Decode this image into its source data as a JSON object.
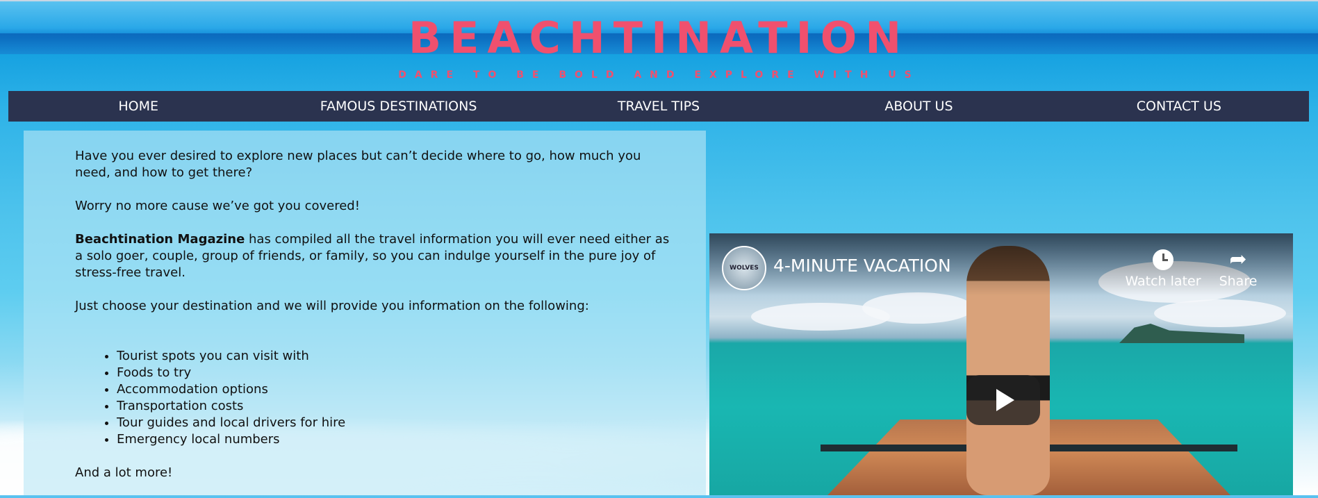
{
  "site": {
    "logo": "BEACHTINATION",
    "tagline": "DARE TO BE BOLD AND EXPLORE WITH US"
  },
  "nav": {
    "items": [
      {
        "label": "HOME"
      },
      {
        "label": "FAMOUS DESTINATIONS"
      },
      {
        "label": "TRAVEL TIPS"
      },
      {
        "label": "ABOUT US"
      },
      {
        "label": "CONTACT US"
      }
    ]
  },
  "intro": {
    "p1": "Have you ever desired to explore new places but can’t decide where to go, how much you need, and how to get there?",
    "p2": "Worry no more cause we’ve got you covered!",
    "p3_bold": "Beachtination Magazine",
    "p3_rest": " has compiled all the travel information you will ever need either as a solo goer, couple, group of friends, or family, so you can indulge yourself in the pure joy of stress-free travel.",
    "p4": "Just choose your destination and we will provide you information on the following:",
    "list": [
      "Tourist spots you can visit with",
      "Foods to try",
      "Accommodation options",
      "Transportation costs",
      "Tour guides and local drivers for hire",
      "Emergency local numbers"
    ],
    "p5": "And a lot more!"
  },
  "video": {
    "title": "4-MINUTE VACATION",
    "channel_avatar_text": "WOLVES",
    "watch_later": "Watch later",
    "share": "Share",
    "icons": {
      "watch_later": "clock-icon",
      "share": "share-arrow-icon",
      "play": "play-icon"
    }
  },
  "colors": {
    "brand_pink": "#f0506e",
    "nav_bg": "#2b334f",
    "nav_text": "#ffffff"
  }
}
